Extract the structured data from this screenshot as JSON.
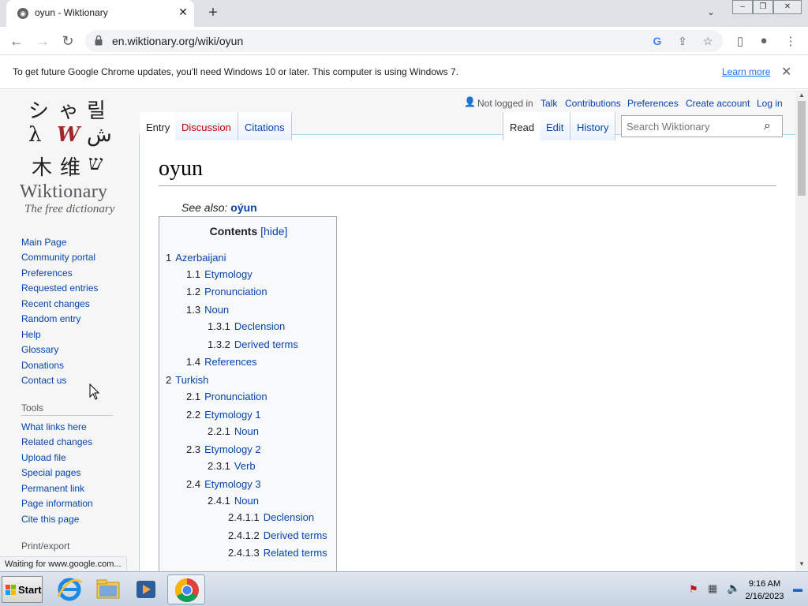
{
  "browser": {
    "tab_title": "oyun - Wiktionary",
    "url": "en.wiktionary.org/wiki/oyun",
    "infobar_message": "To get future Google Chrome updates, you'll need Windows 10 or later. This computer is using Windows 7.",
    "infobar_link": "Learn more",
    "status_text": "Waiting for www.google.com..."
  },
  "logo": {
    "name": "Wiktionary",
    "tagline": "The free dictionary"
  },
  "sidebar": {
    "navigation": [
      "Main Page",
      "Community portal",
      "Preferences",
      "Requested entries",
      "Recent changes",
      "Random entry",
      "Help",
      "Glossary",
      "Donations",
      "Contact us"
    ],
    "tools_heading": "Tools",
    "tools": [
      "What links here",
      "Related changes",
      "Upload file",
      "Special pages",
      "Permanent link",
      "Page information",
      "Cite this page"
    ],
    "print_heading": "Print/export"
  },
  "personal": {
    "not_logged_in": "Not logged in",
    "links": [
      "Talk",
      "Contributions",
      "Preferences",
      "Create account",
      "Log in"
    ]
  },
  "page_tabs": {
    "left": [
      "Entry",
      "Discussion",
      "Citations"
    ],
    "right": [
      "Read",
      "Edit",
      "History"
    ]
  },
  "search": {
    "placeholder": "Search Wiktionary"
  },
  "article": {
    "title": "oyun",
    "see_also_label": "See also:",
    "see_also_link": "oýun"
  },
  "toc": {
    "title": "Contents",
    "hide": "[hide]",
    "items": [
      {
        "num": "1",
        "label": "Azerbaijani"
      },
      {
        "num": "1.1",
        "label": "Etymology"
      },
      {
        "num": "1.2",
        "label": "Pronunciation"
      },
      {
        "num": "1.3",
        "label": "Noun"
      },
      {
        "num": "1.3.1",
        "label": "Declension"
      },
      {
        "num": "1.3.2",
        "label": "Derived terms"
      },
      {
        "num": "1.4",
        "label": "References"
      },
      {
        "num": "2",
        "label": "Turkish"
      },
      {
        "num": "2.1",
        "label": "Pronunciation"
      },
      {
        "num": "2.2",
        "label": "Etymology 1"
      },
      {
        "num": "2.2.1",
        "label": "Noun"
      },
      {
        "num": "2.3",
        "label": "Etymology 2"
      },
      {
        "num": "2.3.1",
        "label": "Verb"
      },
      {
        "num": "2.4",
        "label": "Etymology 3"
      },
      {
        "num": "2.4.1",
        "label": "Noun"
      },
      {
        "num": "2.4.1.1",
        "label": "Declension"
      },
      {
        "num": "2.4.1.2",
        "label": "Derived terms"
      },
      {
        "num": "2.4.1.3",
        "label": "Related terms"
      }
    ]
  },
  "taskbar": {
    "start_label": "Start",
    "time": "9:16 AM",
    "date": "2/16/2023"
  },
  "colors": {
    "link": "#0645ad",
    "chrome_tabstrip": "#dee1e6",
    "taskbar": "#c7d3e2"
  }
}
